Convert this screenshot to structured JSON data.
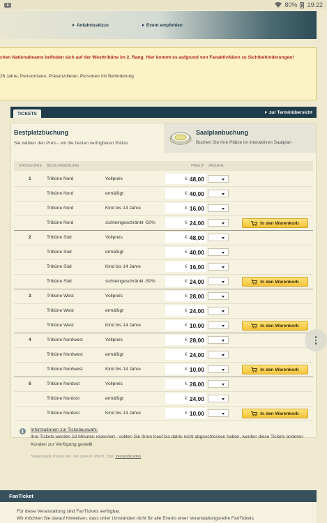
{
  "status_bar": {
    "battery": "80%",
    "time": "19:22"
  },
  "nav": {
    "link1": "Anfahrtsskizze",
    "link2": "Event empfehlen"
  },
  "warning": {
    "highlight": "chen Nationalteams befinden sich auf der Westtribüne im 2. Rang. Hier kommt es aufgrund von Fanaktivitäten zu Sichtbehinderungen!",
    "text": "26 Jahre, Pensionisten, Präsenzdiener, Personen mit Behinderung"
  },
  "tickets": {
    "tab": "TICKETS",
    "overview_link": "zur Terminübersicht"
  },
  "best": {
    "title": "Bestplatzbuchung",
    "subtitle": "Sie wählen den Preis - wir die besten verfügbaren Plätze"
  },
  "saal": {
    "title": "Saalplanbuchung",
    "subtitle": "Buchen Sie Ihre Plätze im interaktiven Saalplan"
  },
  "table_headers": {
    "kategorie": "KATEGORIE",
    "beschreibung": "BESCHREIBUNG",
    "preis": "PREIS*",
    "anzahl": "ANZAHL"
  },
  "currency": "€",
  "cart_label": "In den Warenkorb",
  "rows": [
    {
      "cat": "1",
      "desc": "Tribüne Nord",
      "type": "Vollpreis",
      "price": "48,00"
    },
    {
      "cat": "",
      "desc": "Tribüne Nord",
      "type": "ermäßigt",
      "price": "40,00"
    },
    {
      "cat": "",
      "desc": "Tribüne Nord",
      "type": "Kind bis 14 Jahre",
      "price": "16,00"
    },
    {
      "cat": "",
      "desc": "Tribüne Nord",
      "type": "sichteingeschränkt -50%",
      "price": "24,00"
    },
    {
      "cat": "2",
      "desc": "Tribüne Süd",
      "type": "Vollpreis",
      "price": "48,00"
    },
    {
      "cat": "",
      "desc": "Tribüne Süd",
      "type": "ermäßigt",
      "price": "40,00"
    },
    {
      "cat": "",
      "desc": "Tribüne Süd",
      "type": "Kind bis 14 Jahre",
      "price": "16,00"
    },
    {
      "cat": "",
      "desc": "Tribüne Süd",
      "type": "sichteingeschränkt -50%",
      "price": "24,00"
    },
    {
      "cat": "3",
      "desc": "Tribüne West",
      "type": "Vollpreis",
      "price": "28,00"
    },
    {
      "cat": "",
      "desc": "Tribüne West",
      "type": "ermäßigt",
      "price": "24,00"
    },
    {
      "cat": "",
      "desc": "Tribüne West",
      "type": "Kind bis 14 Jahre",
      "price": "10,00"
    },
    {
      "cat": "4",
      "desc": "Tribüne Nordwest",
      "type": "Vollpreis",
      "price": "28,00"
    },
    {
      "cat": "",
      "desc": "Tribüne Nordwest",
      "type": "ermäßigt",
      "price": "24,00"
    },
    {
      "cat": "",
      "desc": "Tribüne Nordwest",
      "type": "Kind bis 14 Jahre",
      "price": "10,00"
    },
    {
      "cat": "6",
      "desc": "Tribüne Nordost",
      "type": "Vollpreis",
      "price": "28,00"
    },
    {
      "cat": "",
      "desc": "Tribüne Nordost",
      "type": "ermäßigt",
      "price": "24,00"
    },
    {
      "cat": "",
      "desc": "Tribüne Nordost",
      "type": "Kind bis 14 Jahre",
      "price": "10,00"
    }
  ],
  "info": {
    "link": "Informationen zur Ticketauswahl.",
    "text": "Ihre Tickets werden 18 Minuten reserviert - sollten Sie Ihren Kauf bis dahin nicht abgeschlossen haben, werden diese Tickets anderen Kunden zur Verfügung gestellt.",
    "fine_prefix": "*Angezeigte Preise inkl. der gesetzl. MwSt. zzgl.",
    "fine_link": "Versandkosten"
  },
  "fanticket": {
    "title": "FanTicket",
    "line1": "Für diese Veranstaltung sind FanTickets verfügbar.",
    "line2": "Wir möchten Sie darauf hinweisen, dass unter Umständen nicht für alle Events einer Veranstaltungsreihe FanTickets"
  }
}
